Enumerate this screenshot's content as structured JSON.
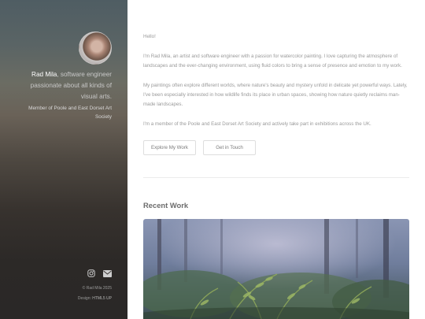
{
  "sidebar": {
    "intro_name": "Rad Mila",
    "intro_rest": ", software engineer passionate about all kinds of visual arts.",
    "member_text": "Member of Poole and East Dorset Art Society",
    "social_icons": [
      "instagram-icon",
      "mail-icon"
    ],
    "footer_copy": "© Rad Mila 2025",
    "footer_design_label": "Design: ",
    "footer_design_link": "HTML5 UP"
  },
  "main": {
    "hello": "Hello!",
    "paragraph_1": "I'm Rad Mila, an artist and software engineer with a passion for watercolor painting. I love capturing the atmosphere of landscapes and the ever-changing environment, using fluid colors to bring a sense of presence and emotion to my work.",
    "paragraph_2": "My paintings often explore different worlds, where nature's beauty and mystery unfold in delicate yet powerful ways. Lately, I've been especially interested in how wildlife finds its place in urban spaces, showing how nature quietly reclaims man-made landscapes.",
    "paragraph_3": "I'm a member of the Poole and East Dorset Art Society and actively take part in exhibitions across the UK.",
    "button_explore": "Explore My Work",
    "button_touch": "Get in Touch",
    "recent_work_title": "Recent Work"
  },
  "colors": {
    "sidebar_top": "#4f5d63",
    "sidebar_bottom": "#2a2827",
    "body_text": "#9a9a9a",
    "heading_text": "#6c6c6c"
  }
}
